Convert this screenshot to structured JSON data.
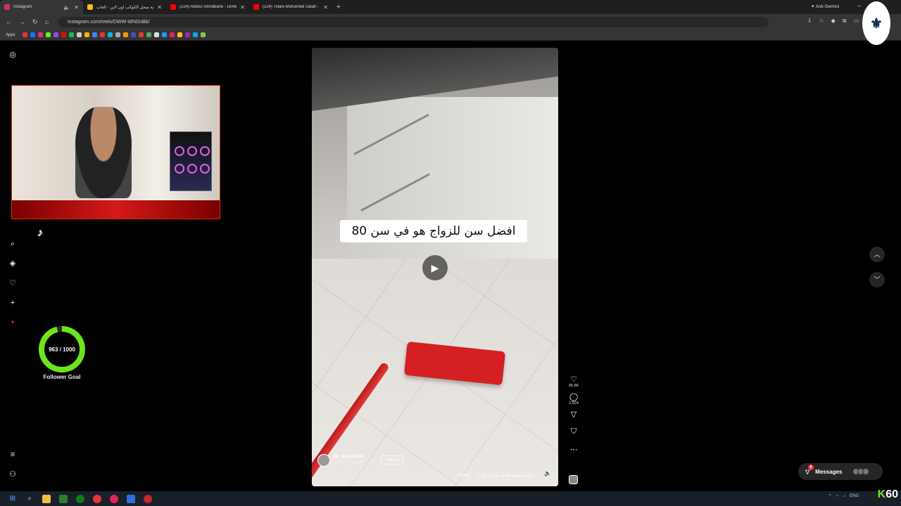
{
  "browser": {
    "tabs": [
      {
        "title": "Instagram",
        "favicon_color": "#d62976",
        "active": true
      },
      {
        "title": "لعبة سحل الكوكب اون لاين - العاب",
        "favicon_color": "#f4c20d",
        "active": false
      },
      {
        "title": "(224) Abdou Ghodbane - DIAM",
        "favicon_color": "#ff0000",
        "active": false
      },
      {
        "title": "(224) Tiliani Mohamed Salah -",
        "favicon_color": "#ff0000",
        "active": false
      }
    ],
    "new_tab": "+",
    "ask_gemini": "Ask Gemini",
    "url": "instagram.com/reels/DWW-WNDnBb/",
    "bookmarks_apps": "Apps"
  },
  "sidebar": {
    "icons": [
      "instagram-icon",
      "search-icon",
      "explore-icon",
      "heart-icon",
      "create-icon",
      "menu-icon",
      "more-icon"
    ]
  },
  "stream": {
    "follower_goal_value": "963 / 1000",
    "follower_goal_progress": 0.963,
    "follower_goal_label": "Follower Goal",
    "accent": "#6ee51a"
  },
  "reel": {
    "caption_overlay": "افضل سن للزواج هو في سن 80",
    "username": "dz_decoration_",
    "location": "Explore - اكسبلور",
    "follow_label": "Follow",
    "description": "ب رايكم ما هو افضل سن للزواج ؟؟ ... more",
    "likes": "96.8K",
    "comments": "2,824"
  },
  "messages": {
    "label": "Messages",
    "badge": "6"
  },
  "taskbar": {
    "tray_lang": "ENG",
    "overlay_count": "60"
  }
}
